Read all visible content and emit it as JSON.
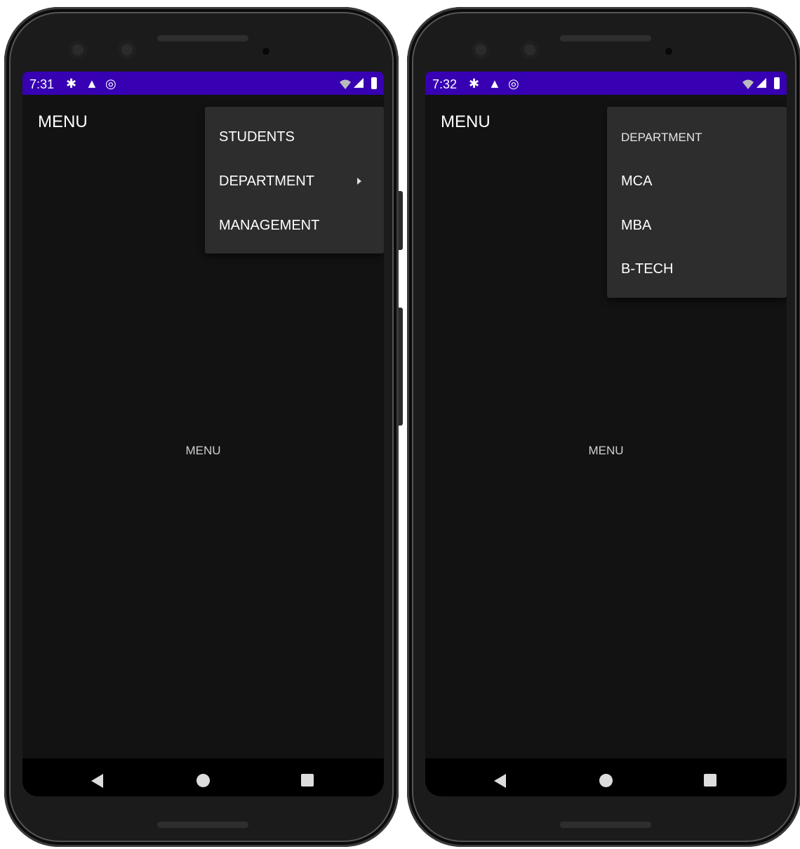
{
  "left": {
    "status": {
      "time": "7:31"
    },
    "app_title": "MENU",
    "center_text": "MENU",
    "menu": {
      "items": [
        "STUDENTS",
        "DEPARTMENT",
        "MANAGEMENT"
      ]
    }
  },
  "right": {
    "status": {
      "time": "7:32"
    },
    "app_title": "MENU",
    "center_text": "MENU",
    "submenu": {
      "header": "DEPARTMENT",
      "items": [
        "MCA",
        "MBA",
        "B-TECH"
      ]
    }
  },
  "colors": {
    "status_bar": "#3700b3",
    "screen_bg": "#121212",
    "menu_bg": "#2d2d2d"
  },
  "icons": [
    "settings-icon",
    "warning-icon",
    "data-saver-icon",
    "wifi-icon",
    "signal-icon",
    "battery-icon",
    "back-icon",
    "home-icon",
    "recents-icon"
  ]
}
